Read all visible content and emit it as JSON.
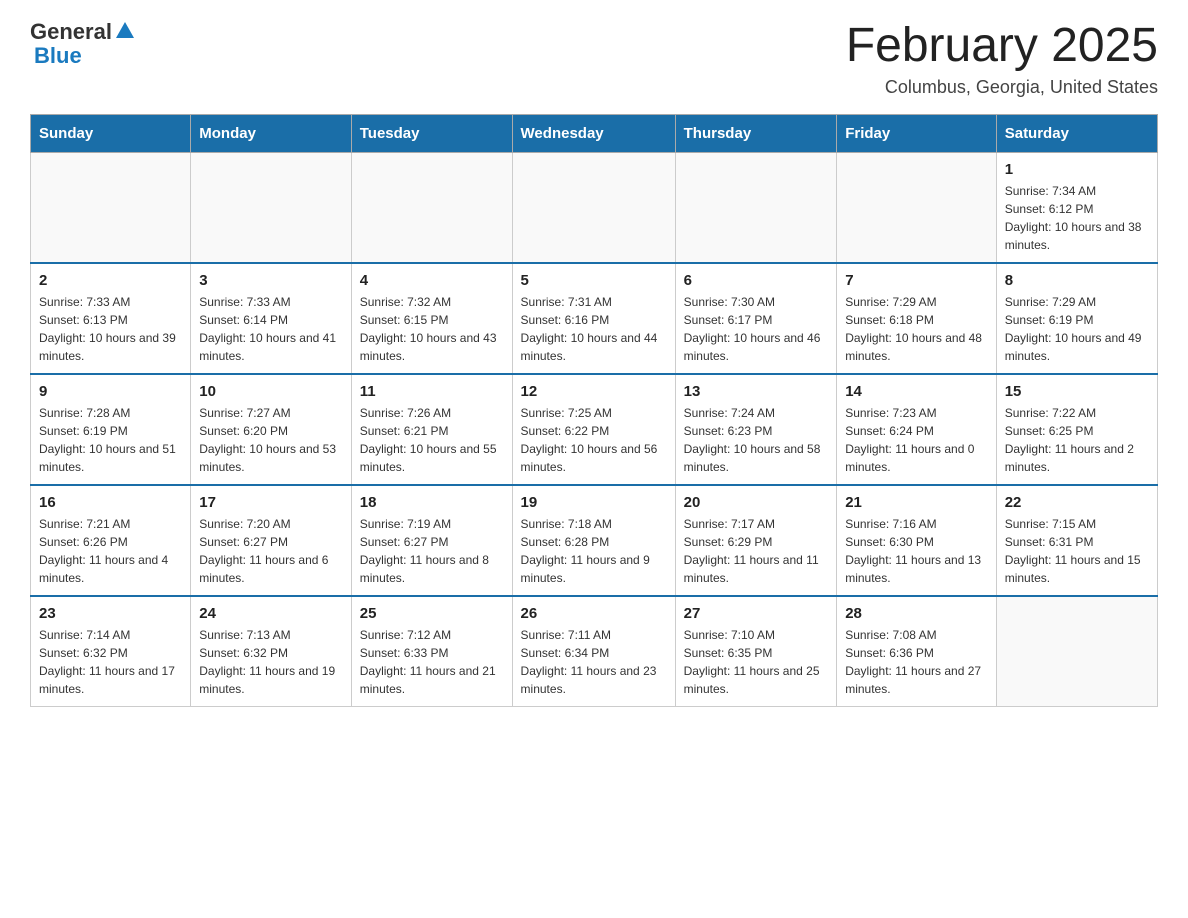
{
  "header": {
    "logo_general": "General",
    "logo_blue": "Blue",
    "month_title": "February 2025",
    "location": "Columbus, Georgia, United States"
  },
  "weekdays": [
    "Sunday",
    "Monday",
    "Tuesday",
    "Wednesday",
    "Thursday",
    "Friday",
    "Saturday"
  ],
  "weeks": [
    [
      {
        "day": "",
        "info": ""
      },
      {
        "day": "",
        "info": ""
      },
      {
        "day": "",
        "info": ""
      },
      {
        "day": "",
        "info": ""
      },
      {
        "day": "",
        "info": ""
      },
      {
        "day": "",
        "info": ""
      },
      {
        "day": "1",
        "info": "Sunrise: 7:34 AM\nSunset: 6:12 PM\nDaylight: 10 hours and 38 minutes."
      }
    ],
    [
      {
        "day": "2",
        "info": "Sunrise: 7:33 AM\nSunset: 6:13 PM\nDaylight: 10 hours and 39 minutes."
      },
      {
        "day": "3",
        "info": "Sunrise: 7:33 AM\nSunset: 6:14 PM\nDaylight: 10 hours and 41 minutes."
      },
      {
        "day": "4",
        "info": "Sunrise: 7:32 AM\nSunset: 6:15 PM\nDaylight: 10 hours and 43 minutes."
      },
      {
        "day": "5",
        "info": "Sunrise: 7:31 AM\nSunset: 6:16 PM\nDaylight: 10 hours and 44 minutes."
      },
      {
        "day": "6",
        "info": "Sunrise: 7:30 AM\nSunset: 6:17 PM\nDaylight: 10 hours and 46 minutes."
      },
      {
        "day": "7",
        "info": "Sunrise: 7:29 AM\nSunset: 6:18 PM\nDaylight: 10 hours and 48 minutes."
      },
      {
        "day": "8",
        "info": "Sunrise: 7:29 AM\nSunset: 6:19 PM\nDaylight: 10 hours and 49 minutes."
      }
    ],
    [
      {
        "day": "9",
        "info": "Sunrise: 7:28 AM\nSunset: 6:19 PM\nDaylight: 10 hours and 51 minutes."
      },
      {
        "day": "10",
        "info": "Sunrise: 7:27 AM\nSunset: 6:20 PM\nDaylight: 10 hours and 53 minutes."
      },
      {
        "day": "11",
        "info": "Sunrise: 7:26 AM\nSunset: 6:21 PM\nDaylight: 10 hours and 55 minutes."
      },
      {
        "day": "12",
        "info": "Sunrise: 7:25 AM\nSunset: 6:22 PM\nDaylight: 10 hours and 56 minutes."
      },
      {
        "day": "13",
        "info": "Sunrise: 7:24 AM\nSunset: 6:23 PM\nDaylight: 10 hours and 58 minutes."
      },
      {
        "day": "14",
        "info": "Sunrise: 7:23 AM\nSunset: 6:24 PM\nDaylight: 11 hours and 0 minutes."
      },
      {
        "day": "15",
        "info": "Sunrise: 7:22 AM\nSunset: 6:25 PM\nDaylight: 11 hours and 2 minutes."
      }
    ],
    [
      {
        "day": "16",
        "info": "Sunrise: 7:21 AM\nSunset: 6:26 PM\nDaylight: 11 hours and 4 minutes."
      },
      {
        "day": "17",
        "info": "Sunrise: 7:20 AM\nSunset: 6:27 PM\nDaylight: 11 hours and 6 minutes."
      },
      {
        "day": "18",
        "info": "Sunrise: 7:19 AM\nSunset: 6:27 PM\nDaylight: 11 hours and 8 minutes."
      },
      {
        "day": "19",
        "info": "Sunrise: 7:18 AM\nSunset: 6:28 PM\nDaylight: 11 hours and 9 minutes."
      },
      {
        "day": "20",
        "info": "Sunrise: 7:17 AM\nSunset: 6:29 PM\nDaylight: 11 hours and 11 minutes."
      },
      {
        "day": "21",
        "info": "Sunrise: 7:16 AM\nSunset: 6:30 PM\nDaylight: 11 hours and 13 minutes."
      },
      {
        "day": "22",
        "info": "Sunrise: 7:15 AM\nSunset: 6:31 PM\nDaylight: 11 hours and 15 minutes."
      }
    ],
    [
      {
        "day": "23",
        "info": "Sunrise: 7:14 AM\nSunset: 6:32 PM\nDaylight: 11 hours and 17 minutes."
      },
      {
        "day": "24",
        "info": "Sunrise: 7:13 AM\nSunset: 6:32 PM\nDaylight: 11 hours and 19 minutes."
      },
      {
        "day": "25",
        "info": "Sunrise: 7:12 AM\nSunset: 6:33 PM\nDaylight: 11 hours and 21 minutes."
      },
      {
        "day": "26",
        "info": "Sunrise: 7:11 AM\nSunset: 6:34 PM\nDaylight: 11 hours and 23 minutes."
      },
      {
        "day": "27",
        "info": "Sunrise: 7:10 AM\nSunset: 6:35 PM\nDaylight: 11 hours and 25 minutes."
      },
      {
        "day": "28",
        "info": "Sunrise: 7:08 AM\nSunset: 6:36 PM\nDaylight: 11 hours and 27 minutes."
      },
      {
        "day": "",
        "info": ""
      }
    ]
  ]
}
